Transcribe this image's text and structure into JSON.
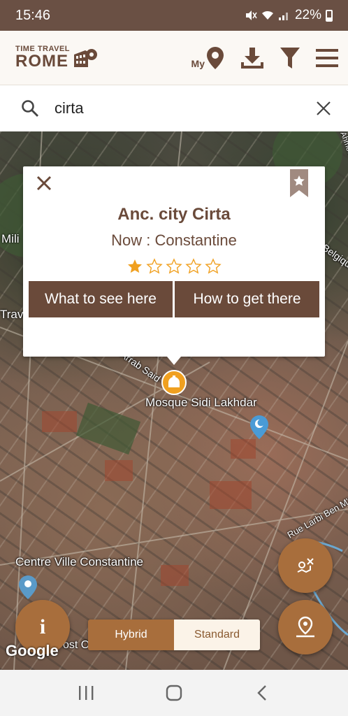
{
  "status_bar": {
    "time": "15:46",
    "battery": "22%"
  },
  "header": {
    "logo_top": "TIME TRAVEL",
    "logo_bottom": "ROME",
    "my_label": "My",
    "icons": [
      "map-pin-icon",
      "download-icon",
      "filter-icon",
      "menu-icon"
    ]
  },
  "search": {
    "value": "cirta",
    "icons": [
      "search-icon",
      "clear-icon"
    ]
  },
  "popup": {
    "title": "Anc. city Cirta",
    "subtitle": "Now :  Constantine",
    "rating": 1,
    "max_rating": 5,
    "buttons": {
      "what": "What to see here",
      "how": "How to get there"
    },
    "colors": {
      "brand": "#6a4a3a",
      "star": "#f0a020"
    }
  },
  "map": {
    "labels": {
      "mosque": "Mosque Sidi Lakhdar",
      "centre": "Centre Ville Constantine",
      "road": "Rue Larbi Ben M'Hidi",
      "mili": "Mili",
      "trave": "Trave",
      "belgique": "Belgique",
      "ued": "Rue Ahmed Rhumel",
      "arrab": "Arrab Said",
      "ost": "ost Office"
    },
    "google": "Google"
  },
  "controls": {
    "info_label": "i",
    "hybrid_label": "Hybrid",
    "standard_label": "Standard",
    "accent": "#a86e3c"
  }
}
